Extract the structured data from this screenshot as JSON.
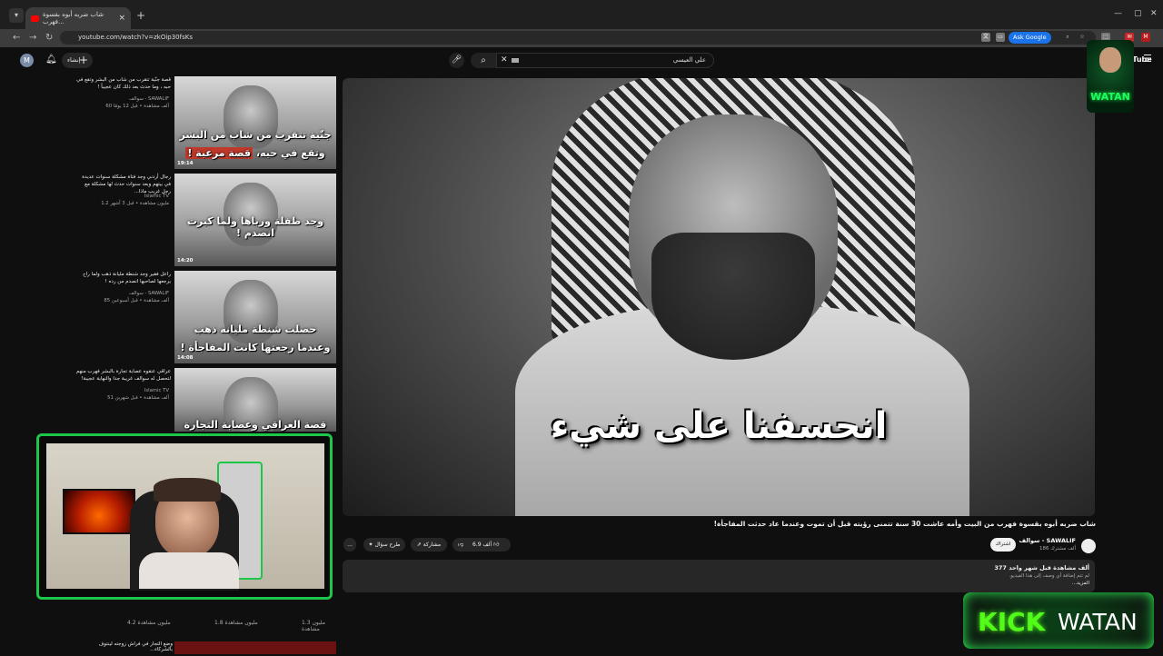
{
  "browser": {
    "tab_title": "شاب ضربه أبوه بقسوة فهرب...",
    "url": "youtube.com/watch?v=zkOip30fsKs",
    "ask_google": "Ask Google"
  },
  "header": {
    "avatar_letter": "M",
    "create_label": "إنشاء",
    "search_query": "علي العيسي",
    "logo_text": "YouTube"
  },
  "sidebar": {
    "items": [
      {
        "title": "قصة جنّية تتقرب من شاب من البشر وتقع في حبه ، وما حدث بعد ذلك كان عجيباً !",
        "channel": "سوالف - SAWALIF",
        "meta": "60 ألف مشاهدة • قبل 12 يومًا",
        "caption1": "جنّية تتقرب من شاب من البشر",
        "caption2": "وتقع في حبه،",
        "caption2_hl": "قصة مرعبة !",
        "duration": "19:14"
      },
      {
        "title": "رجال أردني وجد فتاة مشكلة سنوات عديدة في بيتهم وبعد سنوات حدث لها مشكلة مع رجل غريب ماذا...",
        "channel": "Islamic TV",
        "meta": "1.2 مليون مشاهدة • قبل 3 أشهر",
        "caption1": "وجد طفلة ورباها ولما كبرت انصدم !",
        "caption2": "",
        "caption2_hl": "",
        "duration": "14:20"
      },
      {
        "title": "راعل فقير وجد شنطة مليانة ذهب ولما راح يرجعها لصاحبها انصدم من رده !",
        "channel": "سوالف - SAWALIF",
        "meta": "85 ألف مشاهدة • قبل أسبوعين",
        "caption1": "حصلت شنطة مليانه ذهب",
        "caption2": "وعندما رجعتها كانت المفاجأة !",
        "caption2_hl": "",
        "duration": "14:08"
      },
      {
        "title": "عراقي عنقوه عصابة تجارة بالبشر فهرب منهم لتحصل له سوالف غريبة جدا والنهاية عجيبة!",
        "channel": "Islamic TV",
        "meta": "51 ألف مشاهدة • قبل شهرين",
        "caption1": "قصة العراقي وعصابة التجارة بالبشر !",
        "caption2": "",
        "caption2_hl": "",
        "duration": ""
      }
    ],
    "stats": [
      "1.3 مليون مشاهدة",
      "1.8 مليون مشاهدة",
      "4.2 مليون مشاهدة"
    ],
    "bottom_title": "وضع التجار في فراش زوجته لينتوف بالشركاء..."
  },
  "video": {
    "subtitle": "انحسفنا على شيء",
    "title": "شاب ضربه أبوه بقسوة فهرب من البيت وأمه عاشت 30 سنة تتمنى رؤيته قبل أن تموت وعندما عاد حدثت المفاجأة!",
    "channel_name": "سوالف - SAWALIF",
    "subscribers": "186 ألف مشترك",
    "subscribe_label": "اشتراك",
    "like_count": "6.9 ألف",
    "share_label": "مشاركة",
    "ask_label": "طرح سؤال",
    "more_label": "...",
    "views_line": "377 ألف مشاهدة قبل شهر واحد",
    "desc_line": "لم تتم إضافة أي وصف إلى هذا الفيديو.",
    "desc_more": "...المزيد"
  },
  "overlay": {
    "watan_logo": "WATAN",
    "kick_label": "KICK",
    "kick_name": "WATAN"
  }
}
